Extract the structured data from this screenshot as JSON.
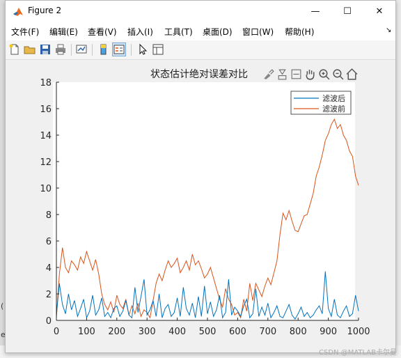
{
  "window": {
    "title": "Figure 2",
    "minimize": "—",
    "maximize": "☐",
    "close": "✕"
  },
  "menu": {
    "items": [
      {
        "label": "文件(F)"
      },
      {
        "label": "编辑(E)"
      },
      {
        "label": "查看(V)"
      },
      {
        "label": "插入(I)"
      },
      {
        "label": "工具(T)"
      },
      {
        "label": "桌面(D)"
      },
      {
        "label": "窗口(W)"
      },
      {
        "label": "帮助(H)"
      }
    ],
    "overflow": "↘"
  },
  "background": {
    "left_text_1": "(",
    "left_text_2": "e",
    "watermark": "CSDN @MATLAB卡尔曼"
  },
  "colors": {
    "filtered": "#0072bd",
    "unfiltered": "#d95319"
  },
  "chart_data": {
    "type": "line",
    "title": "状态估计绝对误差对比",
    "xlim": [
      0,
      1000
    ],
    "ylim": [
      0,
      18
    ],
    "xticks": [
      0,
      100,
      200,
      300,
      400,
      500,
      600,
      700,
      800,
      900,
      1000
    ],
    "yticks": [
      0,
      2,
      4,
      6,
      8,
      10,
      12,
      14,
      16,
      18
    ],
    "legend_position": "top-right",
    "grid": false,
    "series": [
      {
        "name": "滤波后",
        "x": [
          0,
          10,
          20,
          30,
          40,
          50,
          60,
          70,
          80,
          90,
          100,
          110,
          120,
          130,
          140,
          150,
          160,
          170,
          180,
          190,
          200,
          210,
          220,
          230,
          240,
          250,
          260,
          270,
          280,
          290,
          300,
          310,
          320,
          330,
          340,
          350,
          360,
          370,
          380,
          390,
          400,
          410,
          420,
          430,
          440,
          450,
          460,
          470,
          480,
          490,
          500,
          510,
          520,
          530,
          540,
          550,
          560,
          570,
          580,
          590,
          600,
          610,
          620,
          630,
          640,
          650,
          660,
          670,
          680,
          690,
          700,
          710,
          720,
          730,
          740,
          750,
          760,
          770,
          780,
          790,
          800,
          810,
          820,
          830,
          840,
          850,
          860,
          870,
          880,
          890,
          900,
          910,
          920,
          930,
          940,
          950,
          960,
          970,
          980,
          990,
          1000
        ],
        "values": [
          0.4,
          2.8,
          1.2,
          0.5,
          2.0,
          0.8,
          1.5,
          0.3,
          0.9,
          1.6,
          0.2,
          0.7,
          1.9,
          0.4,
          0.8,
          1.7,
          0.3,
          0.6,
          0.2,
          0.9,
          1.1,
          0.3,
          0.7,
          1.5,
          0.4,
          0.2,
          2.5,
          0.6,
          1.8,
          3.1,
          0.4,
          0.8,
          1.5,
          0.3,
          2.0,
          0.2,
          0.9,
          1.2,
          0.3,
          0.6,
          1.7,
          0.3,
          2.5,
          0.9,
          0.4,
          1.3,
          0.2,
          1.8,
          0.3,
          2.6,
          0.5,
          1.4,
          0.3,
          0.8,
          1.9,
          0.2,
          0.6,
          3.1,
          0.4,
          1.0,
          0.7,
          0.3,
          1.1,
          1.6,
          0.2,
          0.5,
          2.4,
          0.3,
          1.0,
          0.4,
          1.3,
          0.2,
          0.6,
          1.1,
          0.3,
          0.2,
          0.7,
          1.2,
          0.4,
          0.1,
          0.5,
          1.0,
          0.3,
          0.6,
          0.2,
          0.4,
          0.8,
          1.1,
          0.5,
          3.7,
          0.9,
          0.3,
          1.6,
          0.4,
          0.2,
          0.7,
          1.1,
          0.3,
          0.5,
          1.9,
          0.7
        ]
      },
      {
        "name": "滤波前",
        "x": [
          0,
          10,
          20,
          30,
          40,
          50,
          60,
          70,
          80,
          90,
          100,
          110,
          120,
          130,
          140,
          150,
          160,
          170,
          180,
          190,
          200,
          210,
          220,
          230,
          240,
          250,
          260,
          270,
          280,
          290,
          300,
          310,
          320,
          330,
          340,
          350,
          360,
          370,
          380,
          390,
          400,
          410,
          420,
          430,
          440,
          450,
          460,
          470,
          480,
          490,
          500,
          510,
          520,
          530,
          540,
          550,
          560,
          570,
          580,
          590,
          600,
          610,
          620,
          630,
          640,
          650,
          660,
          670,
          680,
          690,
          700,
          710,
          720,
          730,
          740,
          750,
          760,
          770,
          780,
          790,
          800,
          810,
          820,
          830,
          840,
          850,
          860,
          870,
          880,
          890,
          900,
          910,
          920,
          930,
          940,
          950,
          960,
          970,
          980,
          990,
          1000
        ],
        "values": [
          0.2,
          3.5,
          5.5,
          4.0,
          3.6,
          4.5,
          4.2,
          3.8,
          4.8,
          4.3,
          5.2,
          4.5,
          3.8,
          4.6,
          3.5,
          2.0,
          1.2,
          0.8,
          1.4,
          0.6,
          1.9,
          1.2,
          0.9,
          1.6,
          0.4,
          1.1,
          0.5,
          1.3,
          0.3,
          0.8,
          0.6,
          0.2,
          1.5,
          2.8,
          3.5,
          3.0,
          3.8,
          4.5,
          4.0,
          4.3,
          4.7,
          3.6,
          4.0,
          4.5,
          3.8,
          5.0,
          4.2,
          4.5,
          3.9,
          3.2,
          3.5,
          4.0,
          3.2,
          2.4,
          1.6,
          1.0,
          2.4,
          1.6,
          1.2,
          0.4,
          0.6,
          0.2,
          1.6,
          0.7,
          2.8,
          1.5,
          2.8,
          2.3,
          1.8,
          2.6,
          3.2,
          2.7,
          3.6,
          4.5,
          6.5,
          8.1,
          7.6,
          8.3,
          7.5,
          6.8,
          6.7,
          7.3,
          7.9,
          8.0,
          8.8,
          9.6,
          10.9,
          11.6,
          12.5,
          13.6,
          14.1,
          14.8,
          15.2,
          14.5,
          14.8,
          14.0,
          13.6,
          12.8,
          12.4,
          10.9,
          10.2
        ]
      }
    ]
  }
}
